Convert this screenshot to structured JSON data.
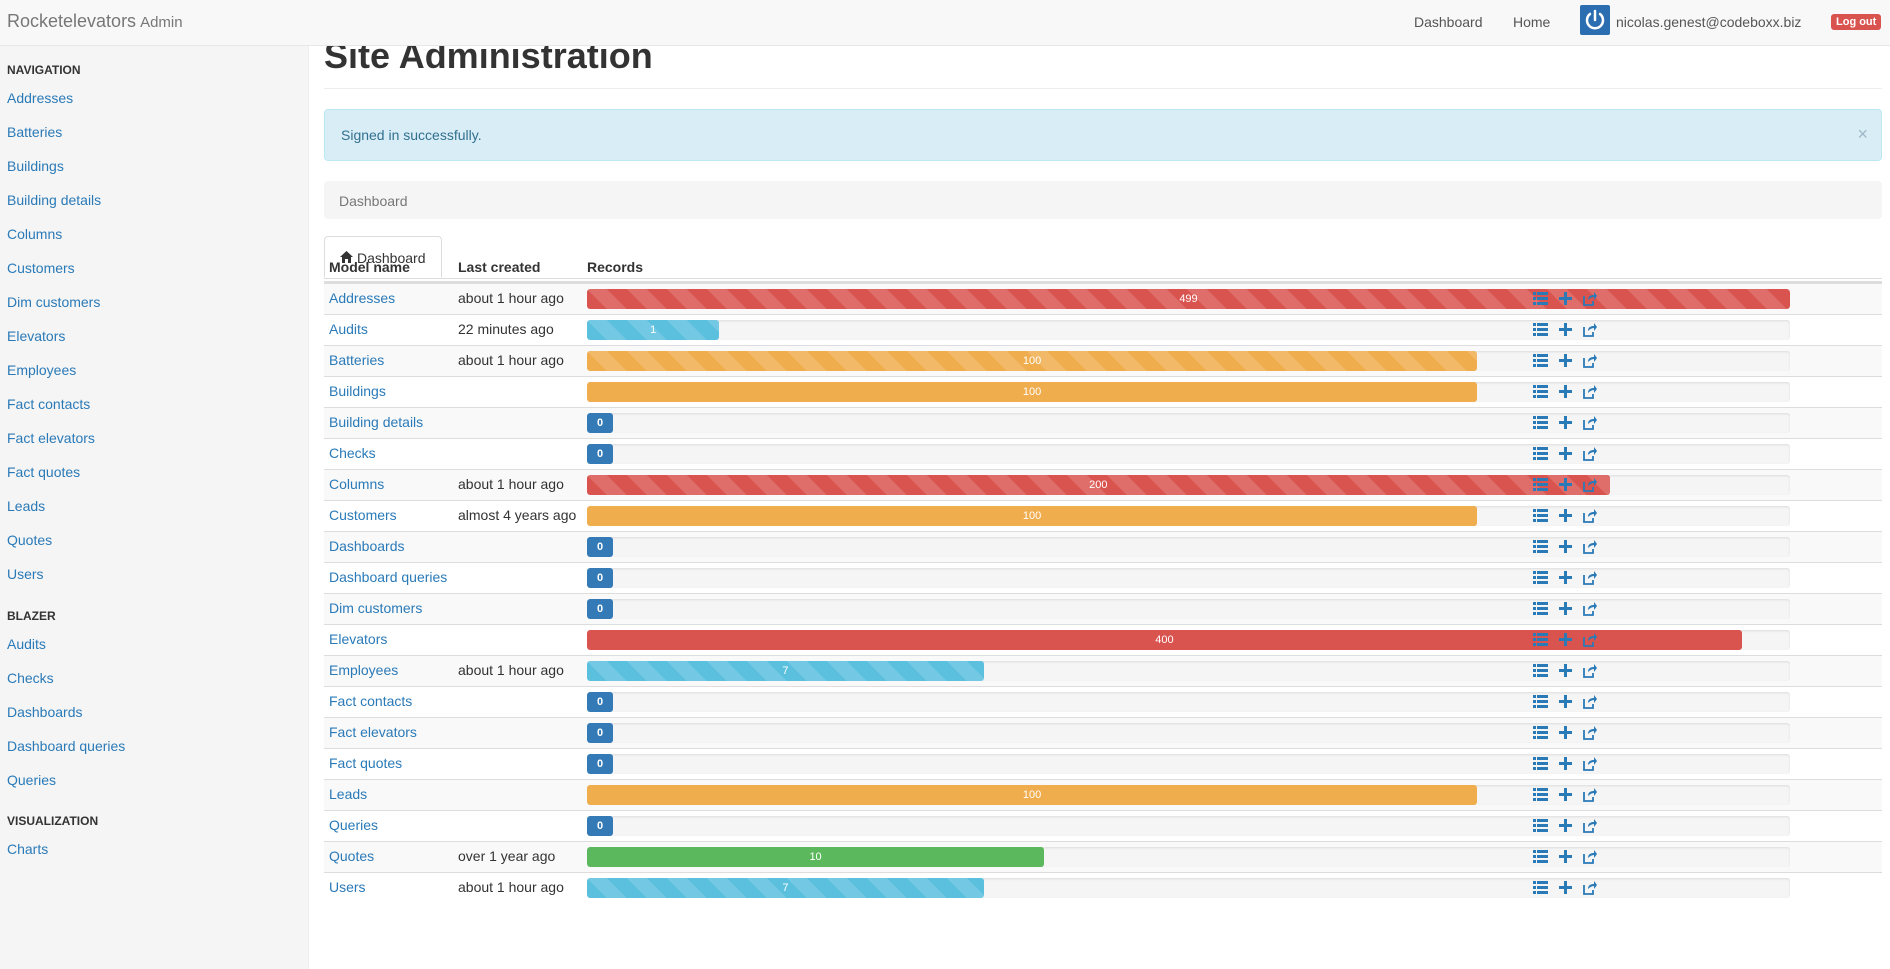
{
  "navbar": {
    "brand": "Rocketelevators",
    "brand_sub": "Admin",
    "links": [
      "Dashboard",
      "Home"
    ],
    "user_email": "nicolas.genest@codeboxx.biz",
    "logout_label": "Log out"
  },
  "sidebar": {
    "sections": [
      {
        "header": "NAVIGATION",
        "items": [
          "Addresses",
          "Batteries",
          "Buildings",
          "Building details",
          "Columns",
          "Customers",
          "Dim customers",
          "Elevators",
          "Employees",
          "Fact contacts",
          "Fact elevators",
          "Fact quotes",
          "Leads",
          "Quotes",
          "Users"
        ]
      },
      {
        "header": "BLAZER",
        "items": [
          "Audits",
          "Checks",
          "Dashboards",
          "Dashboard queries",
          "Queries"
        ]
      },
      {
        "header": "VISUALIZATION",
        "items": [
          "Charts"
        ]
      }
    ]
  },
  "main": {
    "title": "Site Administration",
    "alert": "Signed in successfully.",
    "alert_close": "×",
    "breadcrumb": "Dashboard",
    "tab_label": "Dashboard",
    "columns": [
      "Model name",
      "Last created",
      "Records"
    ],
    "rows": [
      {
        "name": "Addresses",
        "last": "about 1 hour ago",
        "count": "499",
        "pct": 100,
        "color": "#d9534f",
        "striped": true
      },
      {
        "name": "Audits",
        "last": "22 minutes ago",
        "count": "1",
        "pct": 11,
        "color": "#5bc0de",
        "striped": true
      },
      {
        "name": "Batteries",
        "last": "about 1 hour ago",
        "count": "100",
        "pct": 74,
        "color": "#f0ad4e",
        "striped": true
      },
      {
        "name": "Buildings",
        "last": "",
        "count": "100",
        "pct": 74,
        "color": "#f0ad4e",
        "striped": false
      },
      {
        "name": "Building details",
        "last": "",
        "count": "0",
        "pct": 0,
        "color": "#337ab7",
        "striped": false
      },
      {
        "name": "Checks",
        "last": "",
        "count": "0",
        "pct": 0,
        "color": "#337ab7",
        "striped": false
      },
      {
        "name": "Columns",
        "last": "about 1 hour ago",
        "count": "200",
        "pct": 85,
        "color": "#d9534f",
        "striped": true
      },
      {
        "name": "Customers",
        "last": "almost 4 years ago",
        "count": "100",
        "pct": 74,
        "color": "#f0ad4e",
        "striped": false
      },
      {
        "name": "Dashboards",
        "last": "",
        "count": "0",
        "pct": 0,
        "color": "#337ab7",
        "striped": false
      },
      {
        "name": "Dashboard queries",
        "last": "",
        "count": "0",
        "pct": 0,
        "color": "#337ab7",
        "striped": false
      },
      {
        "name": "Dim customers",
        "last": "",
        "count": "0",
        "pct": 0,
        "color": "#337ab7",
        "striped": false
      },
      {
        "name": "Elevators",
        "last": "",
        "count": "400",
        "pct": 96,
        "color": "#d9534f",
        "striped": false
      },
      {
        "name": "Employees",
        "last": "about 1 hour ago",
        "count": "7",
        "pct": 33,
        "color": "#5bc0de",
        "striped": true
      },
      {
        "name": "Fact contacts",
        "last": "",
        "count": "0",
        "pct": 0,
        "color": "#337ab7",
        "striped": false
      },
      {
        "name": "Fact elevators",
        "last": "",
        "count": "0",
        "pct": 0,
        "color": "#337ab7",
        "striped": false
      },
      {
        "name": "Fact quotes",
        "last": "",
        "count": "0",
        "pct": 0,
        "color": "#337ab7",
        "striped": false
      },
      {
        "name": "Leads",
        "last": "",
        "count": "100",
        "pct": 74,
        "color": "#f0ad4e",
        "striped": false
      },
      {
        "name": "Queries",
        "last": "",
        "count": "0",
        "pct": 0,
        "color": "#337ab7",
        "striped": false
      },
      {
        "name": "Quotes",
        "last": "over 1 year ago",
        "count": "10",
        "pct": 38,
        "color": "#5cb85c",
        "striped": false
      },
      {
        "name": "Users",
        "last": "about 1 hour ago",
        "count": "7",
        "pct": 33,
        "color": "#5bc0de",
        "striped": true
      }
    ],
    "row_actions": [
      "list-icon",
      "plus-icon",
      "share-icon"
    ]
  }
}
